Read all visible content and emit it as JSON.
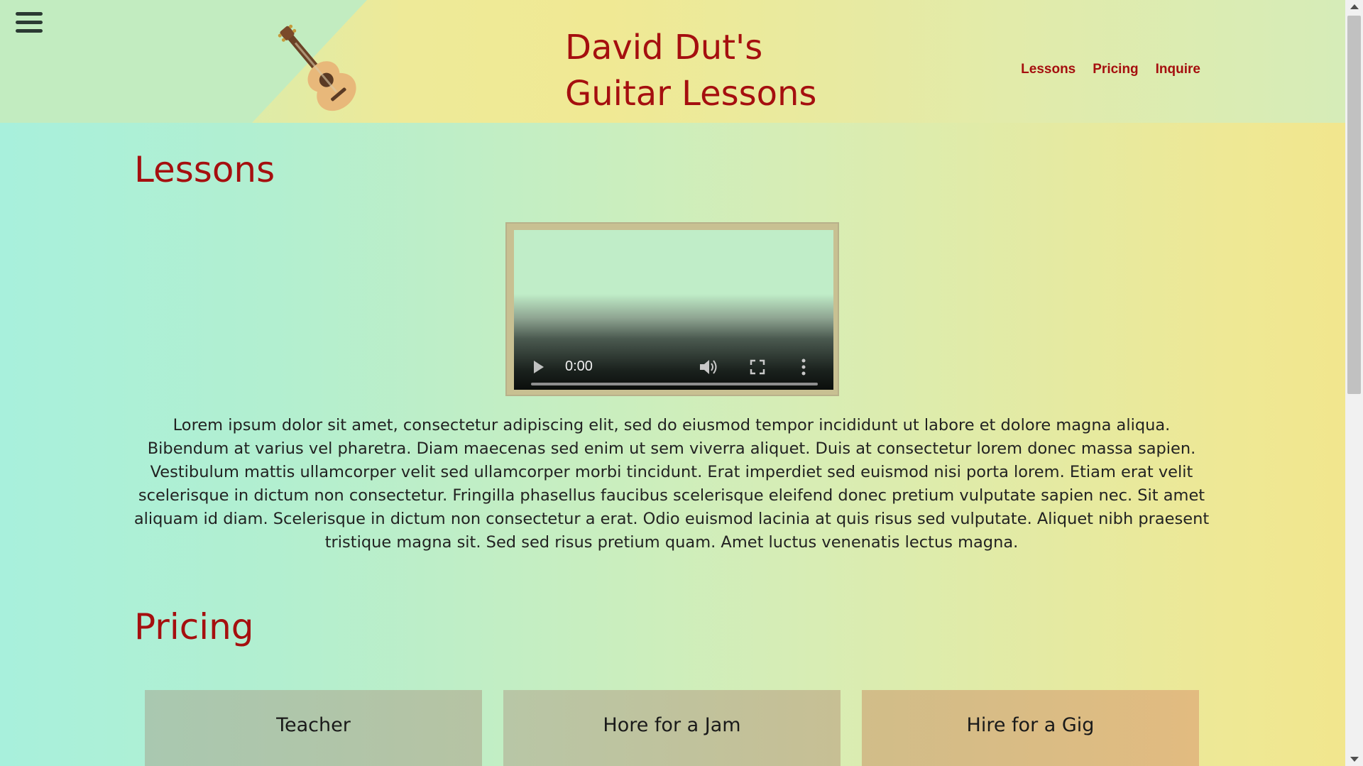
{
  "header": {
    "title_line1": "David Dut's",
    "title_line2": "Guitar Lessons",
    "nav": [
      "Lessons",
      "Pricing",
      "Inquire"
    ]
  },
  "lessons": {
    "heading": "Lessons",
    "video": {
      "time": "0:00",
      "progress": 0
    },
    "text": "Lorem ipsum dolor sit amet, consectetur adipiscing elit, sed do eiusmod tempor incididunt ut labore et dolore magna aliqua. Bibendum at varius vel pharetra. Diam maecenas sed enim ut sem viverra aliquet. Duis at consectetur lorem donec massa sapien. Vestibulum mattis ullamcorper velit sed ullamcorper morbi tincidunt. Erat imperdiet sed euismod nisi porta lorem. Etiam erat velit scelerisque in dictum non consectetur. Fringilla phasellus faucibus scelerisque eleifend donec pretium vulputate sapien nec. Sit amet aliquam id diam. Scelerisque in dictum non consectetur a erat. Odio euismod lacinia at quis risus sed vulputate. Aliquet nibh praesent tristique magna sit. Sed sed risus pretium quam. Amet luctus venenatis lectus magna."
  },
  "pricing": {
    "heading": "Pricing",
    "cards": [
      "Teacher",
      "Hore for a Jam",
      "Hire for a Gig"
    ]
  },
  "colors": {
    "accent": "#a50f0f",
    "text": "#222222"
  },
  "icons": {
    "menu": "hamburger-menu-icon",
    "logo": "guitar-icon",
    "play": "play-icon",
    "volume": "volume-icon",
    "fullscreen": "fullscreen-icon",
    "more": "more-vertical-icon"
  }
}
